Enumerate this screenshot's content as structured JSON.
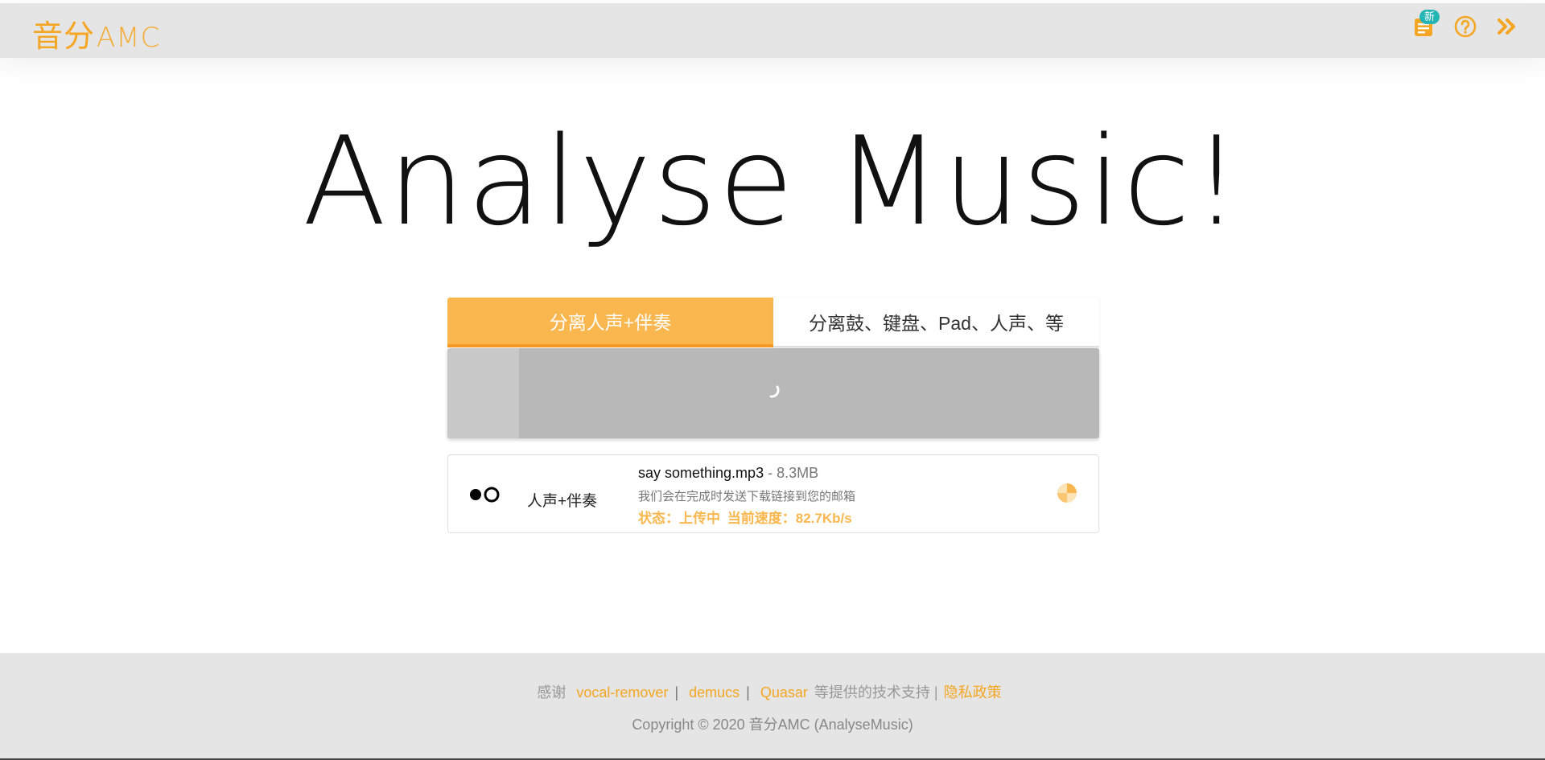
{
  "header": {
    "logo_cn": "音分",
    "logo_en": "AMC",
    "badge_new": "新",
    "icons": [
      "notes-icon",
      "help-icon",
      "double-chevron-right-icon"
    ],
    "accent_color": "#f5a623"
  },
  "hero": {
    "title": "Analyse Music!"
  },
  "tabs": [
    {
      "label": "分离人声+伴奏",
      "active": true
    },
    {
      "label": "分离鼓、键盘、Pad、人声、等",
      "active": false
    }
  ],
  "upload": {
    "progress_fraction": 0.11
  },
  "task": {
    "type_label": "人声+伴奏",
    "filename": "say something.mp3",
    "size": " - 8.3MB",
    "note": "我们会在完成时发送下载链接到您的邮箱",
    "status_label": "状态：上传中",
    "speed_label": "当前速度：82.7Kb/s"
  },
  "footer": {
    "thanks": "感谢",
    "link1": "vocal-remover",
    "sep": "|",
    "link2": "demucs",
    "link3": "Quasar",
    "tail": "等提供的技术支持 |",
    "privacy": "隐私政策",
    "copyright": "Copyright © 2020 音分AMC (AnalyseMusic)"
  }
}
